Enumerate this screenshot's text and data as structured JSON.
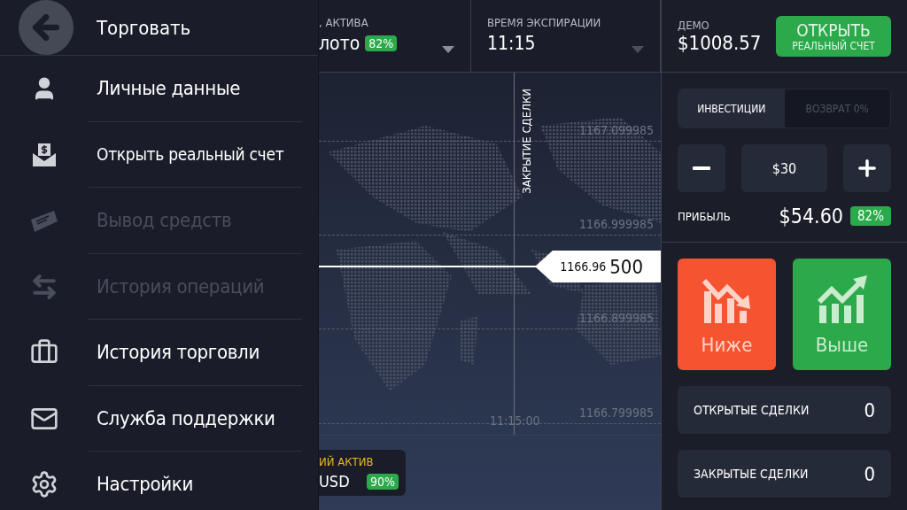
{
  "drawer": {
    "back_label": "Торговать",
    "items": [
      {
        "kind": "user",
        "label": "Личные данные",
        "disabled": false
      },
      {
        "kind": "envelope-dollar",
        "label": "Открыть реальный счет",
        "disabled": false
      },
      {
        "kind": "cheque",
        "label": "Вывод средств",
        "disabled": true
      },
      {
        "kind": "transfer",
        "label": "История операций",
        "disabled": true
      },
      {
        "kind": "briefcase",
        "label": "История торговли",
        "disabled": false
      },
      {
        "kind": "mail",
        "label": "Служба поддержки",
        "disabled": false
      },
      {
        "kind": "settings",
        "label": "Настройки",
        "disabled": false
      }
    ]
  },
  "asset_selector": {
    "label": ", АКТИВА",
    "value": "лото",
    "payout": "82%"
  },
  "expiry_selector": {
    "label": "ВРЕМЯ ЭКСПИРАЦИИ",
    "value": "11:15"
  },
  "chart": {
    "closing_label": "ЗАКРЫТИЕ СДЕЛКИ",
    "price_levels": [
      "1167.099985",
      "1166.999985",
      "1166.899985",
      "1166.799985"
    ],
    "time_label": "11:15:00",
    "current_price": "1166.96",
    "current_amount": "500"
  },
  "asset_card": {
    "label": "ИЙ АКТИВ",
    "value": "USD",
    "payout": "90%"
  },
  "account": {
    "mode": "ДЕМО",
    "balance": "$1008.57",
    "open_button": {
      "line_1": "ОТКРЫТЬ",
      "line_2": "РЕАЛЬНЫЙ СЧЕТ"
    }
  },
  "amount_tabs": [
    {
      "label": "ИНВЕСТИЦИИ",
      "selected": true
    },
    {
      "label": "ВОЗВРАТ 0%",
      "selected": false
    }
  ],
  "stepper": {
    "value": "$30"
  },
  "profit": {
    "label": "ПРИБЫЛЬ",
    "value": "$54.60",
    "payout": "82%"
  },
  "trade_buttons": [
    {
      "kind": "down",
      "label": "Ниже"
    },
    {
      "kind": "up",
      "label": "Выше"
    }
  ],
  "deal_counters": [
    {
      "label": "ОТКРЫТЫЕ СДЕЛКИ",
      "count": "0"
    },
    {
      "label": "ЗАКРЫТЫЕ СДЕЛКИ",
      "count": "0"
    }
  ]
}
